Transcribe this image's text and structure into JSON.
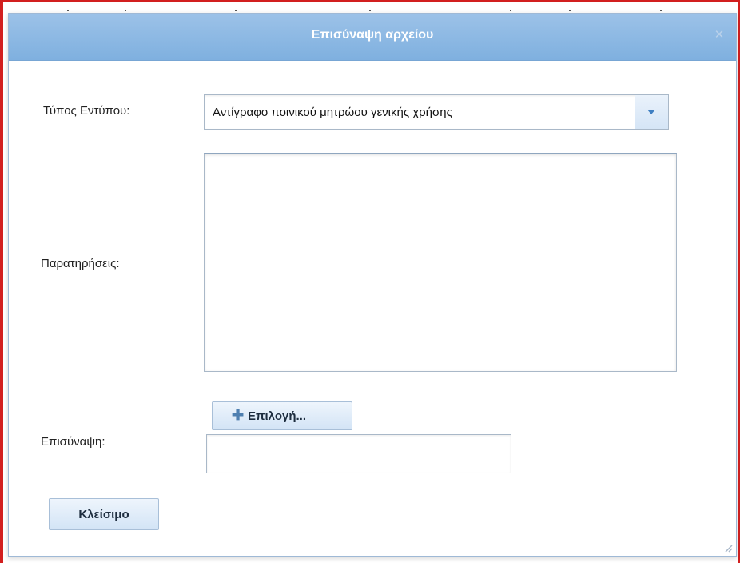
{
  "dialog": {
    "title": "Επισύναψη αρχείου",
    "close_icon": "close-icon"
  },
  "form": {
    "type_label": "Τύπος Εντύπου:",
    "type_value": "Αντίγραφο ποινικού μητρώου γενικής χρήσης",
    "notes_label": "Παρατηρήσεις:",
    "notes_value": "",
    "attachment_label": "Επισύναψη:",
    "select_button_icon": "plus-icon",
    "select_button_label": "Επιλογή...",
    "attachment_value": ""
  },
  "footer": {
    "close_button_label": "Κλείσιμο"
  },
  "colors": {
    "titlebar": "#8ab8e4",
    "window_border": "#d21f1f",
    "button_bg": "#dfeaf7",
    "accent": "#3f7fc2"
  }
}
